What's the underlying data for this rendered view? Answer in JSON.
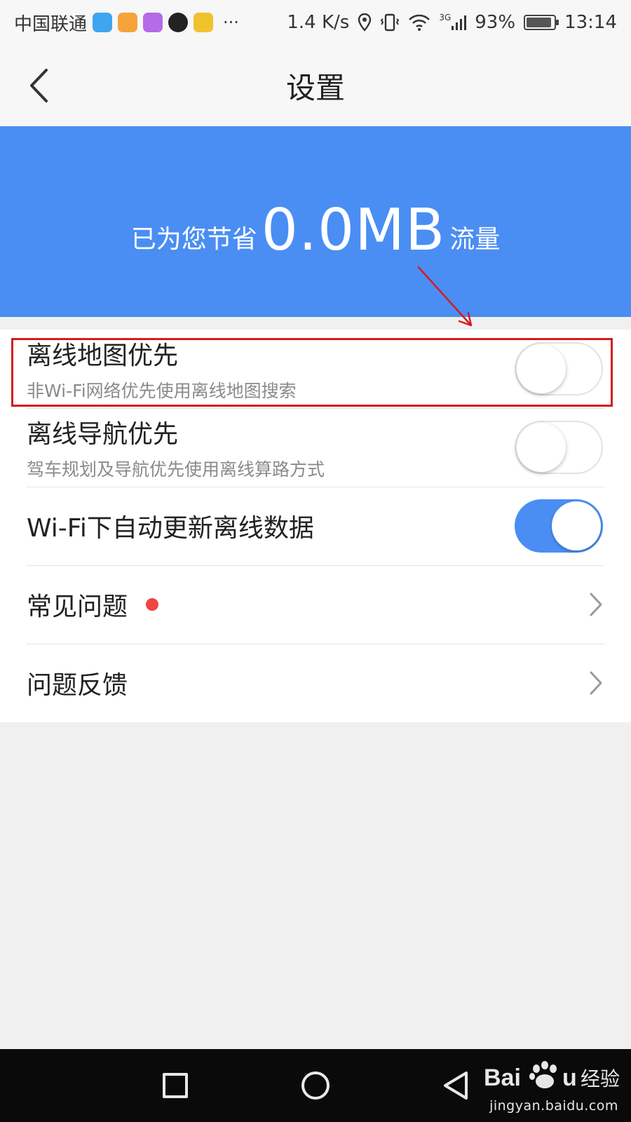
{
  "status_bar": {
    "carrier": "中国联通",
    "more": "···",
    "speed": "1.4 K/s",
    "network": "3G",
    "battery_percent": "93%",
    "battery_level": 0.93,
    "time": "13:14",
    "app_icon_colors": [
      "#3ea6ee",
      "#f5a33b",
      "#b56ae6",
      "#222222",
      "#f2c12e"
    ]
  },
  "nav": {
    "title": "设置",
    "back_icon": "chevron-left-icon"
  },
  "banner": {
    "prefix": "已为您节省",
    "value": "0.0MB",
    "suffix": "流量",
    "color": "#4a8ef3"
  },
  "settings": [
    {
      "title": "离线地图优先",
      "subtitle": "非Wi-Fi网络优先使用离线地图搜索",
      "toggle_on": false
    },
    {
      "title": "离线导航优先",
      "subtitle": "驾车规划及导航优先使用离线算路方式",
      "toggle_on": false
    },
    {
      "title": "Wi-Fi下自动更新离线数据",
      "toggle_on": true
    },
    {
      "title": "常见问题",
      "has_red_dot": true
    },
    {
      "title": "问题反馈"
    }
  ],
  "accent_color": "#4a8ef3",
  "annotation_color": "#d71a20",
  "watermark": {
    "domain": "jingyan.baidu.com"
  }
}
